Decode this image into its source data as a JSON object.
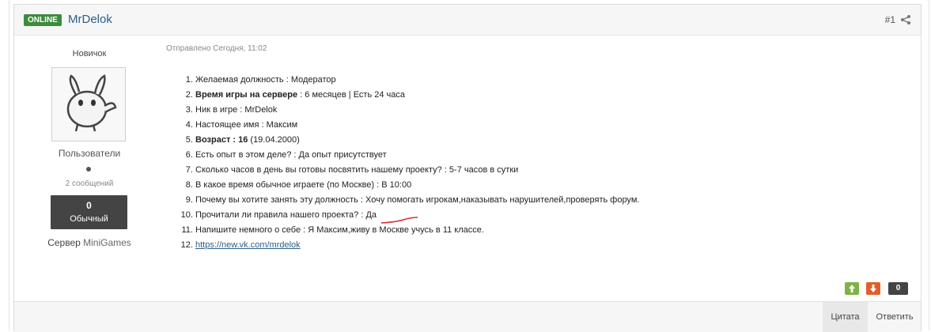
{
  "header": {
    "online_badge": "ONLINE",
    "author_name": "MrDelok",
    "post_number": "#1"
  },
  "author": {
    "rank": "Новичок",
    "group": "Пользователи",
    "posts_count": "2 сообщений",
    "reputation_value": "0",
    "reputation_label": "Обычный",
    "server_prefix": "Сервер ",
    "server_name": "MiniGames"
  },
  "post": {
    "posted_date": "Отправлено Сегодня, 11:02",
    "items": [
      {
        "label": "Желаемая должность",
        "value": " : Модератор"
      },
      {
        "label": "Время игры на сервере",
        "value": " : 6 месяцев | Есть 24 часа"
      },
      {
        "label": "Ник в игре",
        "value": " : MrDelok"
      },
      {
        "label": "Настоящее имя",
        "value": " : Максим"
      },
      {
        "label": "Возраст : 16",
        "value": " (19.04.2000)"
      },
      {
        "label": "Есть опыт в этом деле?",
        "value": " : Да опыт присутствует"
      },
      {
        "label": "Сколько часов в день вы готовы посвятить нашему проекту?",
        "value": " : 5-7 часов в сутки"
      },
      {
        "label": "В какое время обычное играете (по Москве)",
        "value": " : В 10:00"
      },
      {
        "label": "Почему вы хотите занять эту должность",
        "value": " : Хочу помогать игрокам,наказывать нарушителей,проверять форум."
      },
      {
        "label": "Прочитали ли правила нашего проекта?",
        "value": " : Да"
      },
      {
        "label": "Напишите немного о себе",
        "value": " : Я Максим,живу в Москве учусь в 11 классе."
      },
      {
        "label": "https://new.vk.com/mrdelok",
        "value": ""
      }
    ]
  },
  "votes": {
    "count": "0"
  },
  "footer": {
    "quote_label": "Цитата",
    "reply_label": "Ответить"
  },
  "icons": {
    "share": "share-icon",
    "vote_up": "arrow-up-icon",
    "vote_down": "arrow-down-icon"
  },
  "colors": {
    "online": "#3d8b3d",
    "link": "#2a5f8a",
    "vote_up": "#7cb342",
    "vote_down": "#e0602a",
    "rep_box": "#444444"
  }
}
